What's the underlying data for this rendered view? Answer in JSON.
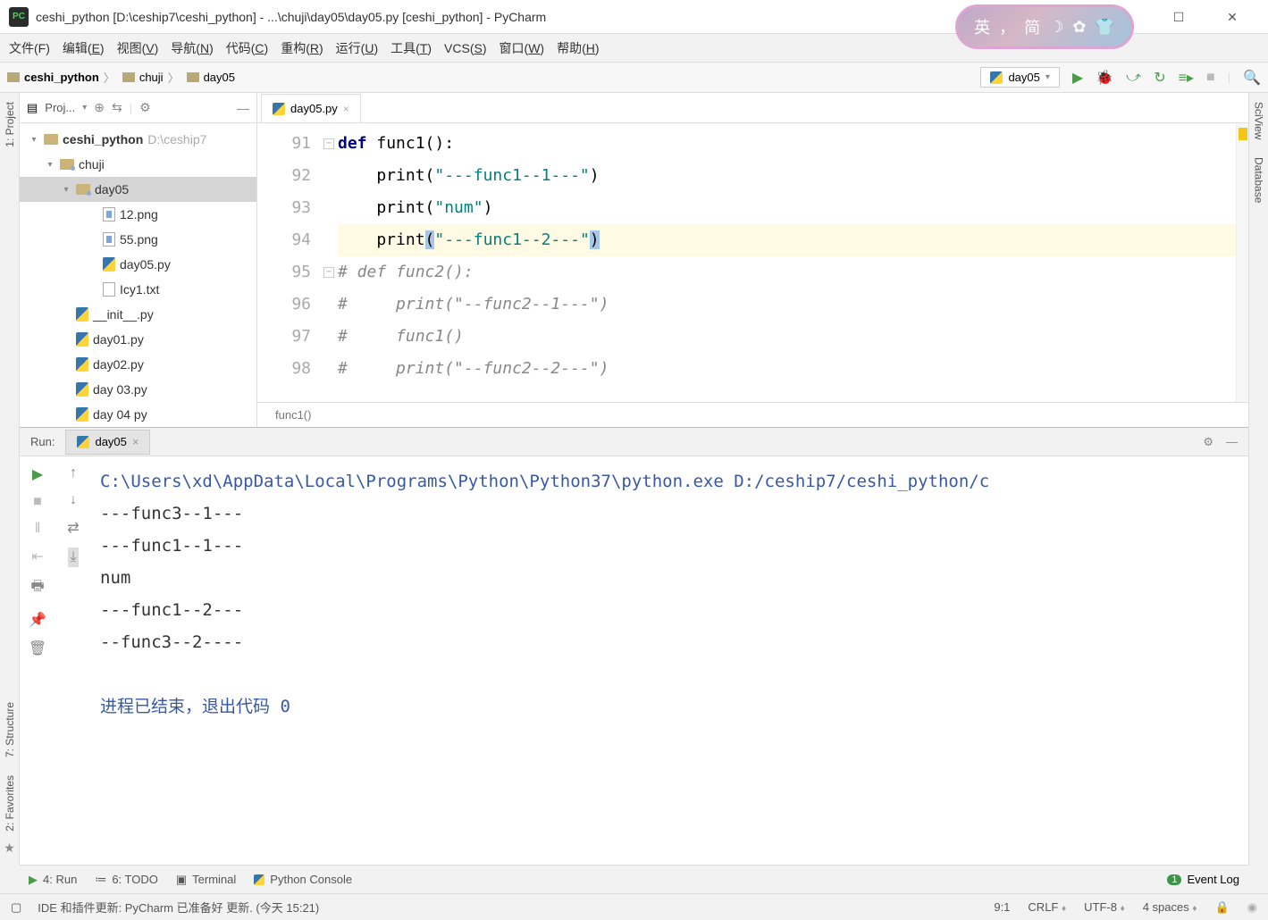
{
  "titlebar": {
    "app_icon": "PC",
    "text": "ceshi_python [D:\\ceship7\\ceshi_python] - ...\\chuji\\day05\\day05.py [ceshi_python] - PyCharm"
  },
  "window_controls": {
    "min": "—",
    "max": "☐",
    "close": "✕"
  },
  "pill": {
    "text1": "英",
    "text2": "简"
  },
  "menu": [
    {
      "pre": "",
      "u": "",
      "post": "文件(F)"
    },
    {
      "pre": "编辑(",
      "u": "E",
      "post": ")"
    },
    {
      "pre": "视图(",
      "u": "V",
      "post": ")"
    },
    {
      "pre": "导航(",
      "u": "N",
      "post": ")"
    },
    {
      "pre": "代码(",
      "u": "C",
      "post": ")"
    },
    {
      "pre": "重构(",
      "u": "R",
      "post": ")"
    },
    {
      "pre": "运行(",
      "u": "U",
      "post": ")"
    },
    {
      "pre": "工具(",
      "u": "T",
      "post": ")"
    },
    {
      "pre": "VCS(",
      "u": "S",
      "post": ")"
    },
    {
      "pre": "窗口(",
      "u": "W",
      "post": ")"
    },
    {
      "pre": "帮助(",
      "u": "H",
      "post": ")"
    }
  ],
  "breadcrumbs": [
    {
      "label": "ceshi_python",
      "bold": true
    },
    {
      "label": "chuji"
    },
    {
      "label": "day05"
    }
  ],
  "run_config": {
    "label": "day05"
  },
  "project_pane": {
    "title": "Proj..."
  },
  "tree": {
    "root": {
      "label": "ceshi_python",
      "hint": "D:\\ceship7"
    },
    "chuji": "chuji",
    "day05": "day05",
    "files": [
      "12.png",
      "55.png",
      "day05.py",
      "Icy1.txt"
    ],
    "siblings": [
      "__init__.py",
      "day01.py",
      "day02.py",
      "day 03.py",
      "day 04 py"
    ]
  },
  "editor": {
    "tab": "day05.py",
    "lines": [
      {
        "n": "91",
        "html": "<span class='kw'>def </span>func1():"
      },
      {
        "n": "92",
        "html": "    print(<span class='str'>\"---func1--1---\"</span>)"
      },
      {
        "n": "93",
        "html": "    print(<span class='str'>\"num\"</span>)"
      },
      {
        "n": "94",
        "html": "    print<span class='sel'>(</span><span class='str'>\"---func1--2---\"</span><span class='sel'>)</span>",
        "hl": true
      },
      {
        "n": "95",
        "html": "<span class='cmt'># def func2():</span>"
      },
      {
        "n": "96",
        "html": "<span class='cmt'>#     print(\"--func2--1---\")</span>"
      },
      {
        "n": "97",
        "html": "<span class='cmt'>#     func1()</span>"
      },
      {
        "n": "98",
        "html": "<span class='cmt'>#     print(\"--func2--2---\")</span>"
      }
    ],
    "crumb": "func1()"
  },
  "run": {
    "label": "Run:",
    "tab": "day05",
    "output": {
      "cmd": "C:\\Users\\xd\\AppData\\Local\\Programs\\Python\\Python37\\python.exe D:/ceship7/ceshi_python/c",
      "lines": [
        "---func3--1---",
        "---func1--1---",
        "num",
        "---func1--2---",
        "--func3--2----"
      ],
      "exit": "进程已结束，退出代码 0"
    }
  },
  "bottom": {
    "run": "4: Run",
    "todo": "6: TODO",
    "terminal": "Terminal",
    "console": "Python Console",
    "event_badge": "1",
    "event": "Event Log"
  },
  "status": {
    "msg": "IDE 和插件更新: PyCharm 已准备好 更新. (今天 15:21)",
    "pos": "9:1",
    "eol": "CRLF",
    "enc": "UTF-8",
    "indent": "4 spaces"
  },
  "left_strip": [
    "1: Project",
    "7: Structure",
    "2: Favorites"
  ],
  "right_strip": [
    "SciView",
    "Database"
  ]
}
